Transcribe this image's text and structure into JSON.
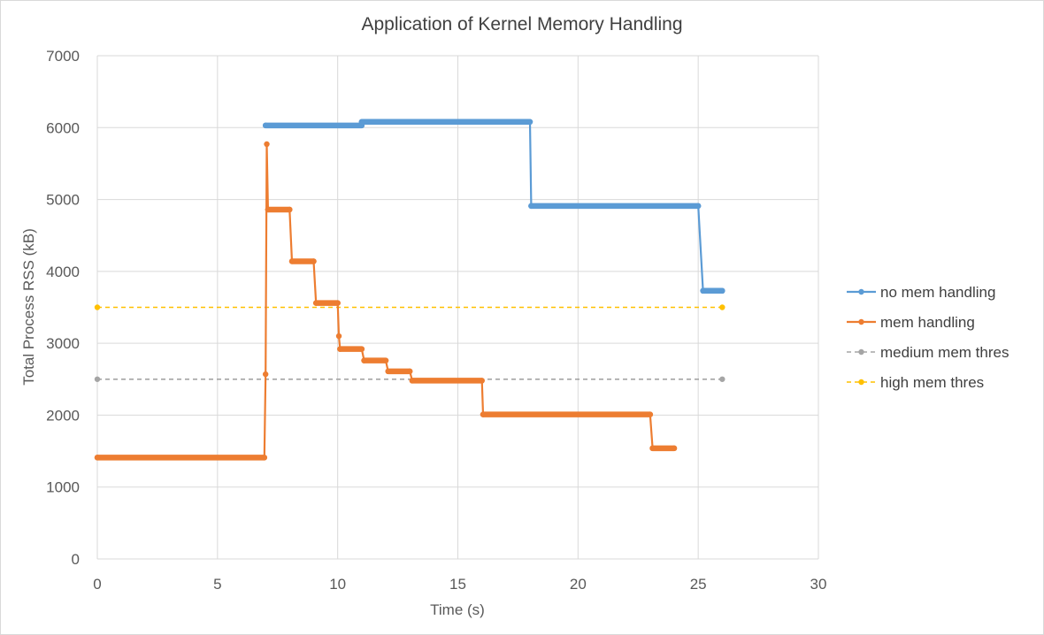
{
  "chart_data": {
    "type": "line",
    "title": "Application of Kernel Memory Handling",
    "xlabel": "Time (s)",
    "ylabel": "Total Process RSS (kB)",
    "xlim": [
      0,
      30
    ],
    "ylim": [
      0,
      7000
    ],
    "xticks": [
      "0",
      "5",
      "10",
      "15",
      "20",
      "25",
      "30"
    ],
    "yticks": [
      "0",
      "1000",
      "2000",
      "3000",
      "4000",
      "5000",
      "6000",
      "7000"
    ],
    "grid": true,
    "legend_position": "right",
    "series": [
      {
        "name": "no mem handling",
        "color": "#5b9bd5",
        "dense_markers": true,
        "points": [
          [
            7.0,
            6030
          ],
          [
            11.0,
            6030
          ],
          [
            11.0,
            6080
          ],
          [
            18.0,
            6080
          ],
          [
            18.05,
            4910
          ],
          [
            25.0,
            4910
          ],
          [
            25.2,
            3730
          ],
          [
            26.0,
            3730
          ]
        ]
      },
      {
        "name": "mem handling",
        "color": "#ed7d31",
        "dense_markers": true,
        "points": [
          [
            0,
            1410
          ],
          [
            6.95,
            1410
          ],
          [
            7.0,
            2570
          ],
          [
            7.05,
            5770
          ],
          [
            7.1,
            4860
          ],
          [
            8.0,
            4860
          ],
          [
            8.1,
            4140
          ],
          [
            9.0,
            4140
          ],
          [
            9.1,
            3560
          ],
          [
            10.0,
            3560
          ],
          [
            10.05,
            3100
          ],
          [
            10.1,
            2920
          ],
          [
            11.0,
            2920
          ],
          [
            11.1,
            2760
          ],
          [
            12.0,
            2760
          ],
          [
            12.1,
            2610
          ],
          [
            13.0,
            2610
          ],
          [
            13.1,
            2480
          ],
          [
            16.0,
            2480
          ],
          [
            16.05,
            2010
          ],
          [
            23.0,
            2010
          ],
          [
            23.1,
            1540
          ],
          [
            24.0,
            1540
          ]
        ]
      },
      {
        "name": "medium mem thres",
        "color": "#a5a5a5",
        "dashed": true,
        "points": [
          [
            0,
            2500
          ],
          [
            26,
            2500
          ]
        ]
      },
      {
        "name": "high mem thres",
        "color": "#ffc000",
        "dashed": true,
        "points": [
          [
            0,
            3500
          ],
          [
            26,
            3500
          ]
        ]
      }
    ]
  }
}
